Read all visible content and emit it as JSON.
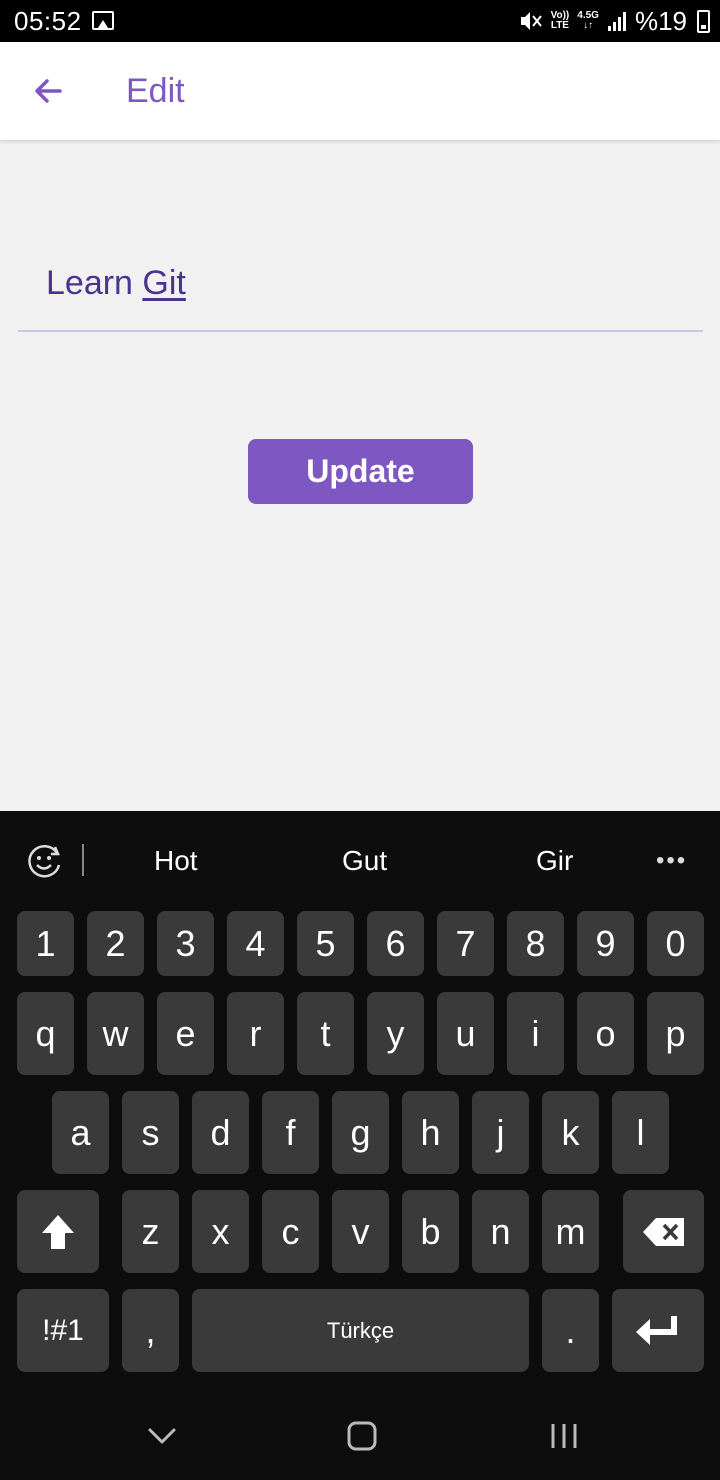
{
  "status_bar": {
    "time": "05:52",
    "network_top": "Vo))",
    "network_bottom": "LTE",
    "speed_top": "4.5G",
    "battery_text": "%19"
  },
  "app_bar": {
    "title": "Edit",
    "back_icon": "arrow-left-icon"
  },
  "form": {
    "field_value_part1": "Learn ",
    "field_value_part2": "Git",
    "update_label": "Update"
  },
  "keyboard": {
    "suggestions": [
      "Hot",
      "Gut",
      "Gir"
    ],
    "more_label": "•••",
    "row_numbers": [
      "1",
      "2",
      "3",
      "4",
      "5",
      "6",
      "7",
      "8",
      "9",
      "0"
    ],
    "row_top": [
      "q",
      "w",
      "e",
      "r",
      "t",
      "y",
      "u",
      "i",
      "o",
      "p"
    ],
    "row_middle": [
      "a",
      "s",
      "d",
      "f",
      "g",
      "h",
      "j",
      "k",
      "l"
    ],
    "row_bottom": [
      "z",
      "x",
      "c",
      "v",
      "b",
      "n",
      "m"
    ],
    "symbols_label": "!#1",
    "comma_label": ",",
    "space_label": "Türkçe",
    "period_label": "."
  },
  "colors": {
    "accent": "#7e57c2",
    "text_primary": "#4a3290",
    "keyboard_bg": "#0d0d0d",
    "key_bg": "#3a3a3a"
  }
}
